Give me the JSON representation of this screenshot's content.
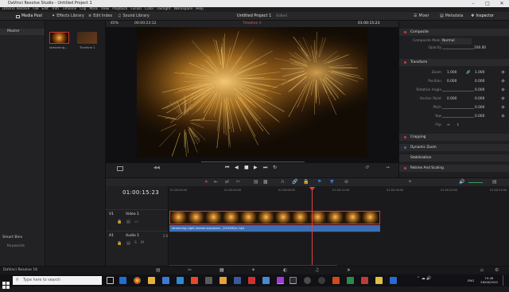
{
  "window": {
    "title": "DaVinci Resolve Studio - Untitled Project 1"
  },
  "menu": [
    "DaVinci Resolve",
    "File",
    "Edit",
    "Trim",
    "Timeline",
    "Clip",
    "Mark",
    "View",
    "Playback",
    "Fusion",
    "Color",
    "Fairlight",
    "Workspace",
    "Help"
  ],
  "toolbar": {
    "media_pool": "Media Pool",
    "effects_library": "Effects Library",
    "edit_index": "Edit Index",
    "sound_library": "Sound Library",
    "project_title": "Untitled Project 1",
    "edited": "Edited",
    "mixer": "Mixer",
    "metadata": "Metadata",
    "inspector": "Inspector"
  },
  "left_panel": {
    "master": "Master",
    "smart_bins": "Smart Bins",
    "keywords": "Keywords"
  },
  "bin": {
    "clips": [
      {
        "label": "streaming..."
      },
      {
        "label": "Timeline 1"
      }
    ]
  },
  "viewer": {
    "zoom": "45%",
    "source_tc": "00:00:23:12",
    "timeline_name": "Timeline 1",
    "record_tc": "01:00:15:23"
  },
  "inspector": {
    "composite": "Composite",
    "composite_mode_label": "Composite Mode",
    "composite_mode_value": "Normal",
    "opacity_label": "Opacity",
    "opacity_value": "100.00",
    "transform": "Transform",
    "zoom_label": "Zoom",
    "zoom_x": "1.000",
    "zoom_y": "1.000",
    "position_label": "Position",
    "position_x": "0.000",
    "position_y": "0.000",
    "rotation_label": "Rotation Angle",
    "rotation_value": "0.000",
    "anchor_label": "Anchor Point",
    "anchor_x": "0.000",
    "anchor_y": "0.000",
    "pitch_label": "Pitch",
    "pitch_value": "0.000",
    "yaw_label": "Yaw",
    "yaw_value": "0.000",
    "flip_label": "Flip",
    "cropping": "Cropping",
    "dynamic_zoom": "Dynamic Zoom",
    "stabilization": "Stabilization",
    "retime_scaling": "Retime And Scaling"
  },
  "timeline": {
    "timecode": "01:00:15:23",
    "ruler": [
      "01:00:00:00",
      "01:00:04:00",
      "01:00:08:00",
      "01:00:12:00",
      "01:00:16:00",
      "01:00:20:00",
      "01:00:24:00"
    ],
    "video_track": {
      "id": "V1",
      "name": "Video 1"
    },
    "audio_track": {
      "id": "A1",
      "name": "Audio 1",
      "level": "2.0"
    },
    "audio_clip_name": "streaming-night-shower-explosion-_2fn34RQn.mp4"
  },
  "bottom": {
    "app_name": "DaVinci Resolve 16"
  },
  "taskbar": {
    "search_placeholder": "Type here to search",
    "language": "ENG",
    "time": "19:46",
    "date": "28/06/2020"
  }
}
